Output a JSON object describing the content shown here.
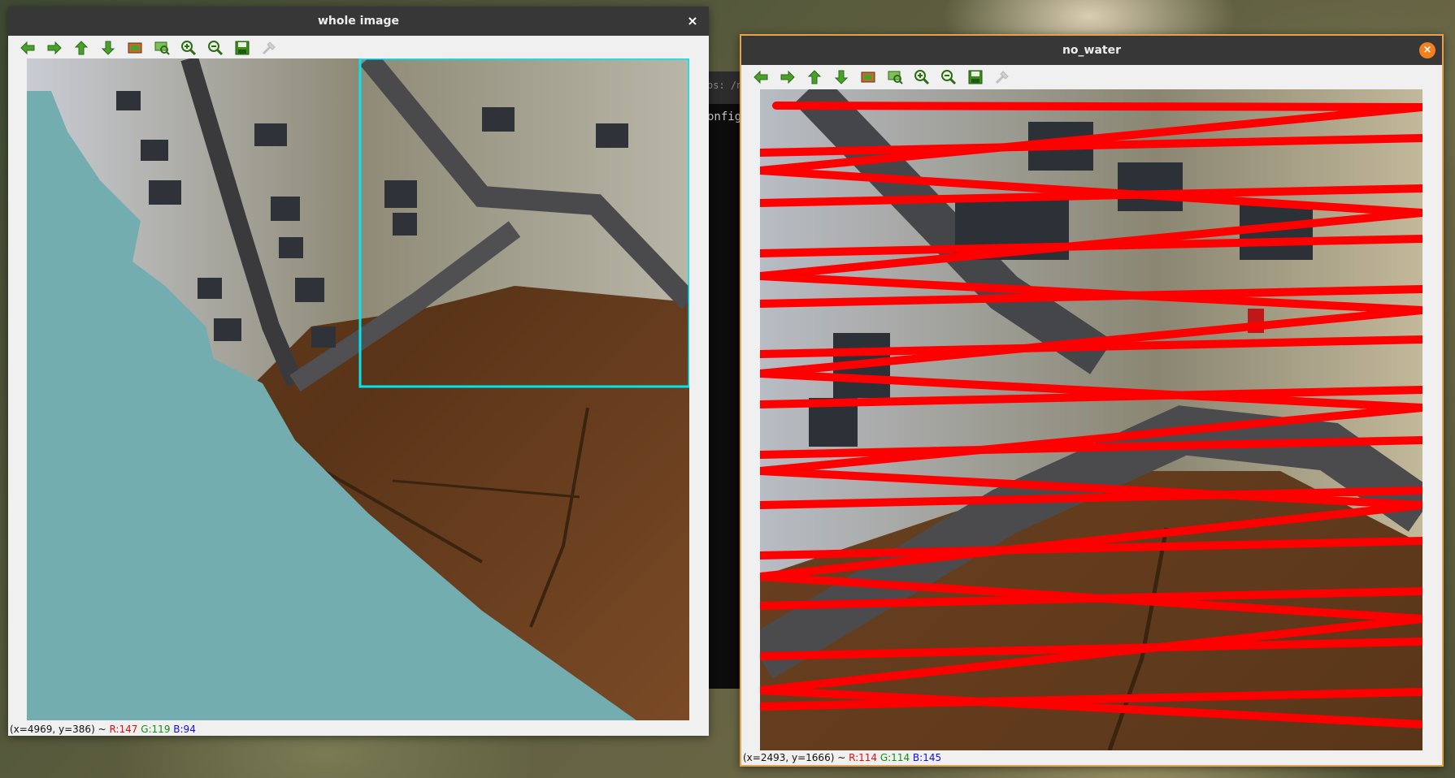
{
  "terminal": {
    "tab_fragment": "os: /n",
    "line_fragment": "onfig"
  },
  "windows": [
    {
      "title": "whole image",
      "close_glyph": "×",
      "status": {
        "coords": "(x=4969, y=386) ~",
        "r": "R:147",
        "g": "G:119",
        "b": "B:94"
      },
      "overlay_color": "#00e5ee",
      "mask_color": "#73adaf"
    },
    {
      "title": "no_water",
      "close_glyph": "×",
      "status": {
        "coords": "(x=2493, y=1666) ~",
        "r": "R:114",
        "g": "G:114",
        "b": "B:145"
      },
      "stroke_color": "#ff0000"
    }
  ],
  "toolbar": [
    {
      "name": "back-icon",
      "tip": "Back"
    },
    {
      "name": "forward-icon",
      "tip": "Forward"
    },
    {
      "name": "up-icon",
      "tip": "Up"
    },
    {
      "name": "down-icon",
      "tip": "Down"
    },
    {
      "name": "reset-view-icon",
      "tip": "Reset view"
    },
    {
      "name": "zoom-rect-icon",
      "tip": "Zoom to rectangle"
    },
    {
      "name": "zoom-in-icon",
      "tip": "Zoom in"
    },
    {
      "name": "zoom-out-icon",
      "tip": "Zoom out"
    },
    {
      "name": "save-icon",
      "tip": "Save"
    },
    {
      "name": "properties-icon",
      "tip": "Properties"
    }
  ]
}
